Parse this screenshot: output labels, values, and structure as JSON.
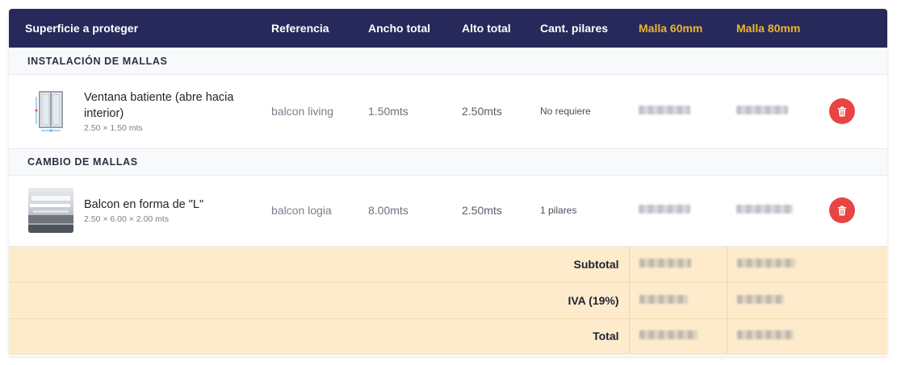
{
  "header": {
    "col_surface": "Superficie a proteger",
    "col_ref": "Referencia",
    "col_width": "Ancho total",
    "col_height": "Alto total",
    "col_pillars": "Cant. pilares",
    "col_mesh60": "Malla 60mm",
    "col_mesh80": "Malla 80mm",
    "accent_color": "#f0b429",
    "bg_color": "#26295a"
  },
  "sections": [
    {
      "title": "INSTALACIÓN DE MALLAS",
      "items": [
        {
          "name": "Ventana batiente (abre hacia interior)",
          "dims": "2.50 × 1.50 mts",
          "icon": "window-icon",
          "reference": "balcon living",
          "width": "1.50mts",
          "height": "2.50mts",
          "pillars": "No requiere"
        }
      ]
    },
    {
      "title": "CAMBIO DE MALLAS",
      "items": [
        {
          "name": "Balcon en forma de \"L\"",
          "dims": "2.50 × 6.00 × 2.00 mts",
          "icon": "l-balcony-photo",
          "reference": "balcon logia",
          "width": "8.00mts",
          "height": "2.50mts",
          "pillars": "1 pilares"
        }
      ]
    }
  ],
  "totals": {
    "subtotal_label": "Subtotal",
    "iva_label": "IVA (19%)",
    "total_label": "Total",
    "bg_color": "#fdebcc"
  },
  "delete_color": "#e84444"
}
